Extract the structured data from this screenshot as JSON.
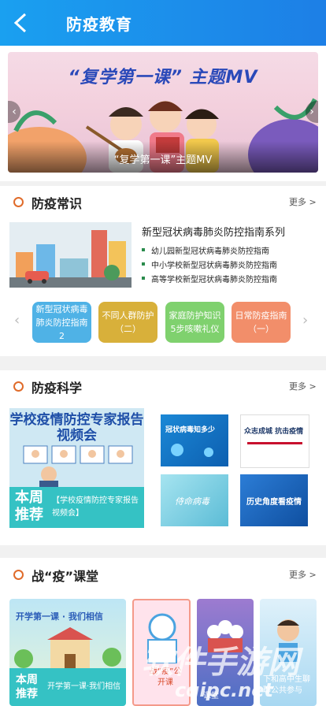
{
  "header": {
    "title": "防疫教育"
  },
  "banner": {
    "title": "“复学第一课” 主题MV",
    "caption": "“复学第一课”主题MV"
  },
  "sec1": {
    "title": "防疫常识",
    "more": "更多 >",
    "guide_title": "新型冠状病毒肺炎防控指南系列",
    "items": [
      "幼儿园新型冠状病毒肺炎防控指南",
      "中小学校新型冠状病毒肺炎防控指南",
      "高等学校新型冠状病毒肺炎防控指南"
    ],
    "tiles": [
      "新型冠状病毒肺炎防控指南2",
      "不同人群防护（二）",
      "家庭防护知识5步咳嗽礼仪",
      "日常防疫指南（一）"
    ],
    "colors": [
      "#4fb2e6",
      "#d8b03a",
      "#7fd16e",
      "#f28e6a"
    ]
  },
  "sec2": {
    "title": "防疫科学",
    "more": "更多 >",
    "feature_title": "学校疫情防控专家报告视频会",
    "week": "本周推荐",
    "feature_caption": "【学校疫情防控专家报告视频会】",
    "thumbs": [
      "冠状病毒知多少",
      "众志成城 抗击疫情",
      "侍命病毒",
      "历史角度看疫情"
    ]
  },
  "sec3": {
    "title": "战“疫”课堂",
    "more": "更多 >",
    "c1_title": "开学第一课 · 我们相信",
    "c1_week": "本周推荐",
    "c1_caption": "开学第一课·我们相信",
    "c2": "战“疫”公开课",
    "c3": "课堂",
    "c4": "下和高中生聊聊公共参与"
  },
  "watermark": {
    "main": "软件手游网",
    "url": "cqipc.net"
  }
}
